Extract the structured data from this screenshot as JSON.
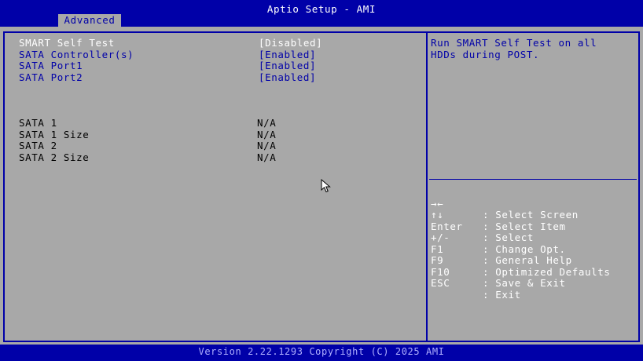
{
  "header": {
    "title": "Aptio Setup - AMI",
    "tab": "Advanced"
  },
  "settings": [
    {
      "label": "SMART Self Test",
      "value": "[Disabled]"
    },
    {
      "label": "SATA Controller(s)",
      "value": "[Enabled]"
    },
    {
      "label": "SATA Port1",
      "value": "[Enabled]"
    },
    {
      "label": "SATA Port2",
      "value": "[Enabled]"
    }
  ],
  "info": [
    {
      "label": "SATA 1",
      "value": "N/A"
    },
    {
      "label": "SATA 1 Size",
      "value": "N/A"
    },
    {
      "label": "SATA 2",
      "value": "N/A"
    },
    {
      "label": "SATA 2 Size",
      "value": "N/A"
    }
  ],
  "help": {
    "text": "Run SMART Self Test on all HDDs during POST."
  },
  "keys": [
    {
      "key": "→←",
      "desc": ": Select Screen"
    },
    {
      "key": "↑↓",
      "desc": ": Select Item"
    },
    {
      "key": "Enter",
      "desc": ": Select"
    },
    {
      "key": "+/-",
      "desc": ": Change Opt."
    },
    {
      "key": "F1",
      "desc": ": General Help"
    },
    {
      "key": "F9",
      "desc": ": Optimized Defaults"
    },
    {
      "key": "F10",
      "desc": ": Save & Exit"
    },
    {
      "key": "ESC",
      "desc": ": Exit"
    }
  ],
  "footer": {
    "text": "Version 2.22.1293 Copyright (C) 2025 AMI"
  },
  "colors": {
    "bios_blue": "#0000a8",
    "panel_gray": "#a8a8a8",
    "highlight_white": "#ffffff",
    "footer_text": "#b0b0ff"
  },
  "icons": {
    "pointer": "mouse-pointer-icon"
  }
}
